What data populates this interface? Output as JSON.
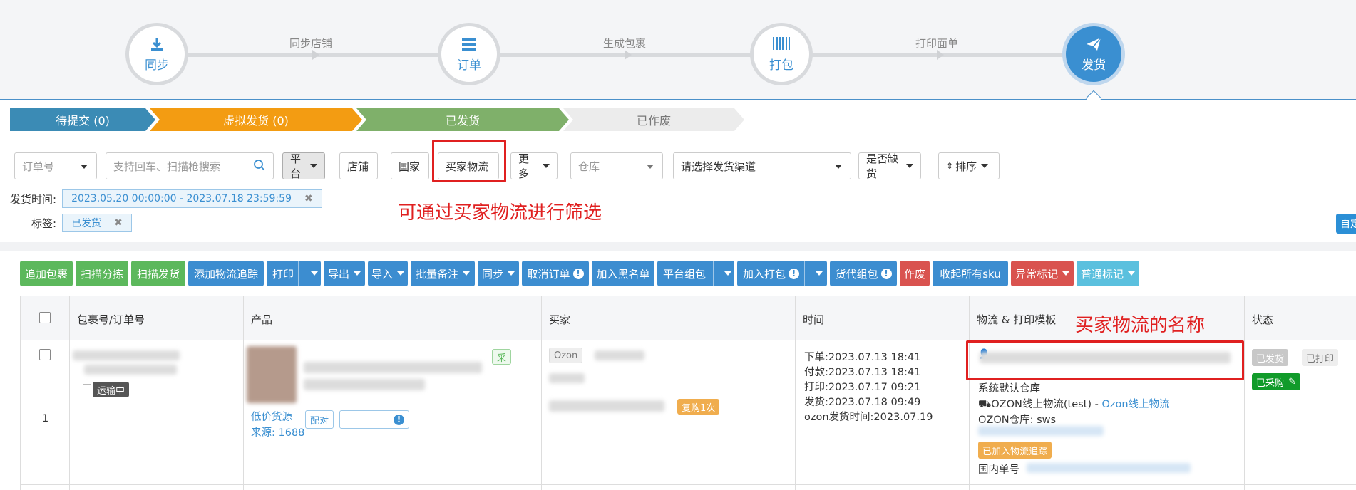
{
  "steps": [
    {
      "label": "同步",
      "icon": "download-icon"
    },
    {
      "label": "订单",
      "icon": "list-icon"
    },
    {
      "label": "打包",
      "icon": "barcode-icon"
    },
    {
      "label": "发货",
      "icon": "send-icon"
    }
  ],
  "step_links": [
    "同步店铺",
    "生成包裹",
    "打印面单"
  ],
  "status_tabs": [
    {
      "label": "待提交 (0)",
      "color": "#3b8bb5"
    },
    {
      "label": "虚拟发货 (0)",
      "color": "#f39c12"
    },
    {
      "label": "已发货",
      "color": "#7fb06a"
    },
    {
      "label": "已作废",
      "color": "#ececec"
    }
  ],
  "filters": {
    "order_no": "订单号",
    "search_placeholder": "支持回车、扫描枪搜索",
    "platform": "平台",
    "shop": "店铺",
    "country": "国家",
    "buyer_logistics": "买家物流",
    "more": "更多",
    "warehouse": "仓库",
    "channel": "请选择发货渠道",
    "stockout": "是否缺货",
    "sort": "排序",
    "ship_time_label": "发货时间:",
    "ship_time_value": "2023.05.20 00:00:00 - 2023.07.18 23:59:59",
    "tag_label": "标签:",
    "tag_value": "已发货",
    "edge_button": "自定"
  },
  "annotations": {
    "filter_note": "可通过买家物流进行筛选",
    "column_note": "买家物流的名称"
  },
  "toolbar": [
    "追加包裹",
    "扫描分拣",
    "扫描发货",
    "添加物流追踪",
    "打印",
    "导出",
    "导入",
    "批量备注",
    "同步",
    "取消订单",
    "加入黑名单",
    "平台组包",
    "加入打包",
    "货代组包",
    "作废",
    "收起所有sku",
    "异常标记",
    "普通标记"
  ],
  "table": {
    "headers": [
      "包裹号/订单号",
      "产品",
      "买家",
      "时间",
      "物流 & 打印模板",
      "状态"
    ],
    "row": {
      "index": "1",
      "transit_badge": "运输中",
      "purchase_badge": "采",
      "product_low_price": "低价货源",
      "product_source": "来源: 1688",
      "product_btn1": "配对",
      "platform_badge": "Ozon",
      "repeat_badge": "复购1次",
      "times": [
        "下单:2023.07.13 18:41",
        "付款:2023.07.13 18:41",
        "打印:2023.07.17 09:21",
        "发货:2023.07.18 09:49",
        "ozon发货时间:2023.07.19"
      ],
      "warehouse": "系统默认仓库",
      "logistics_prefix": "OZON线上物流(test) - ",
      "logistics_link": "Ozon线上物流",
      "ozon_warehouse": "OZON仓库: sws",
      "tracking_badge": "已加入物流追踪",
      "domestic_no": "国内单号",
      "status_shipped": "已发货",
      "status_printed": "已打印",
      "status_purchased": "已采购"
    }
  }
}
